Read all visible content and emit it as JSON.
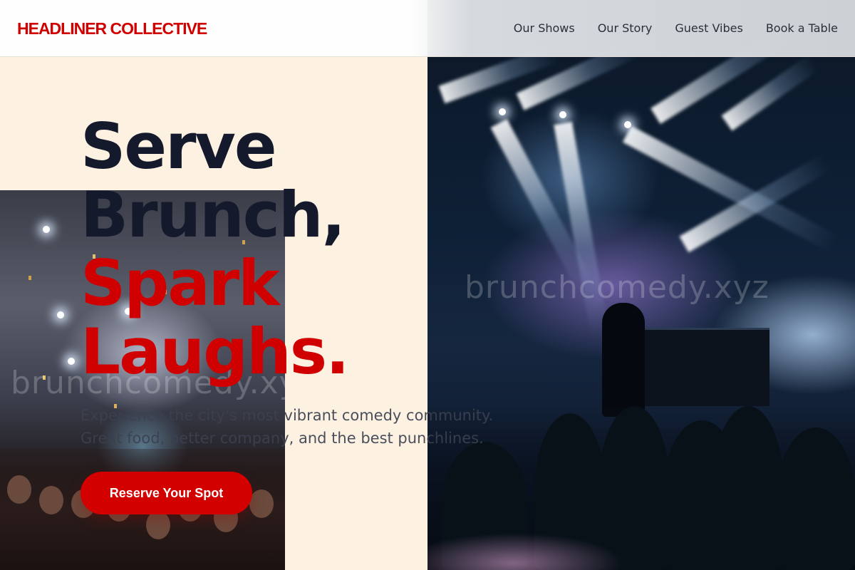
{
  "brand": {
    "name": "HEADLINER COLLECTIVE",
    "color": "#d10000"
  },
  "nav": {
    "links": [
      "Our Shows",
      "Our Story",
      "Guest Vibes",
      "Book a Table"
    ]
  },
  "hero": {
    "title_line1": "Serve",
    "title_line2": "Brunch,",
    "title_line3": "Spark",
    "title_line4": "Laughs.",
    "subtitle_line1": "Experience the city's most vibrant comedy community.",
    "subtitle_line2": "Great food, better company, and the best punchlines.",
    "cta_label": "Reserve Your Spot"
  },
  "images": {
    "left_alt": "crowd-under-confetti-photo",
    "right_alt": "concert-stage-lights-photo"
  },
  "watermarks": {
    "text": "brunchcomedy.xyz"
  },
  "colors": {
    "accent": "#d10000",
    "background": "#fdf2e2",
    "heading": "#141a2c"
  }
}
